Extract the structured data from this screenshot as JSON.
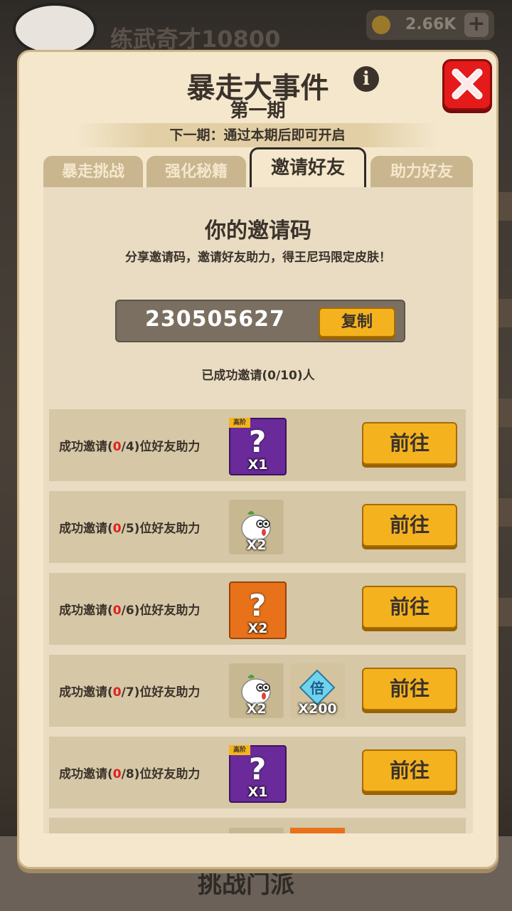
{
  "background": {
    "player_name": "练武奇才10800",
    "currency": "2.66K",
    "bottom_label": "挑战门派"
  },
  "modal": {
    "title": "暴走大事件",
    "period": "第一期",
    "notice": "下一期：通过本期后即可开启",
    "tabs": [
      {
        "label": "暴走挑战",
        "active": false
      },
      {
        "label": "强化秘籍",
        "active": false
      },
      {
        "label": "邀请好友",
        "active": true
      },
      {
        "label": "助力好友",
        "active": false
      }
    ],
    "invite": {
      "heading": "你的邀请码",
      "description": "分享邀请码，邀请好友助力，得王尼玛限定皮肤！",
      "code": "230505627",
      "copy_label": "复制",
      "invited_status": "已成功邀请(0/10)人"
    },
    "tasks": [
      {
        "prefix": "成功邀请(",
        "current": "0",
        "suffix": "/4)位好友助力",
        "button": "前往",
        "rewards": [
          {
            "kind": "purple",
            "tag": "高阶",
            "qty": "X1"
          }
        ]
      },
      {
        "prefix": "成功邀请(",
        "current": "0",
        "suffix": "/5)位好友助力",
        "button": "前往",
        "rewards": [
          {
            "kind": "tan",
            "qty": "X2"
          }
        ]
      },
      {
        "prefix": "成功邀请(",
        "current": "0",
        "suffix": "/6)位好友助力",
        "button": "前往",
        "rewards": [
          {
            "kind": "orange",
            "qty": "X2"
          }
        ]
      },
      {
        "prefix": "成功邀请(",
        "current": "0",
        "suffix": "/7)位好友助力",
        "button": "前往",
        "rewards": [
          {
            "kind": "tan",
            "qty": "X2"
          },
          {
            "kind": "diamond",
            "glyph": "倍",
            "qty": "X200"
          }
        ]
      },
      {
        "prefix": "成功邀请(",
        "current": "0",
        "suffix": "/8)位好友助力",
        "button": "前往",
        "rewards": [
          {
            "kind": "purple",
            "tag": "高阶",
            "qty": "X1"
          }
        ]
      }
    ]
  },
  "colors": {
    "accent": "#f5b21f",
    "close": "#e51a1a",
    "progress_red": "#e02020"
  }
}
